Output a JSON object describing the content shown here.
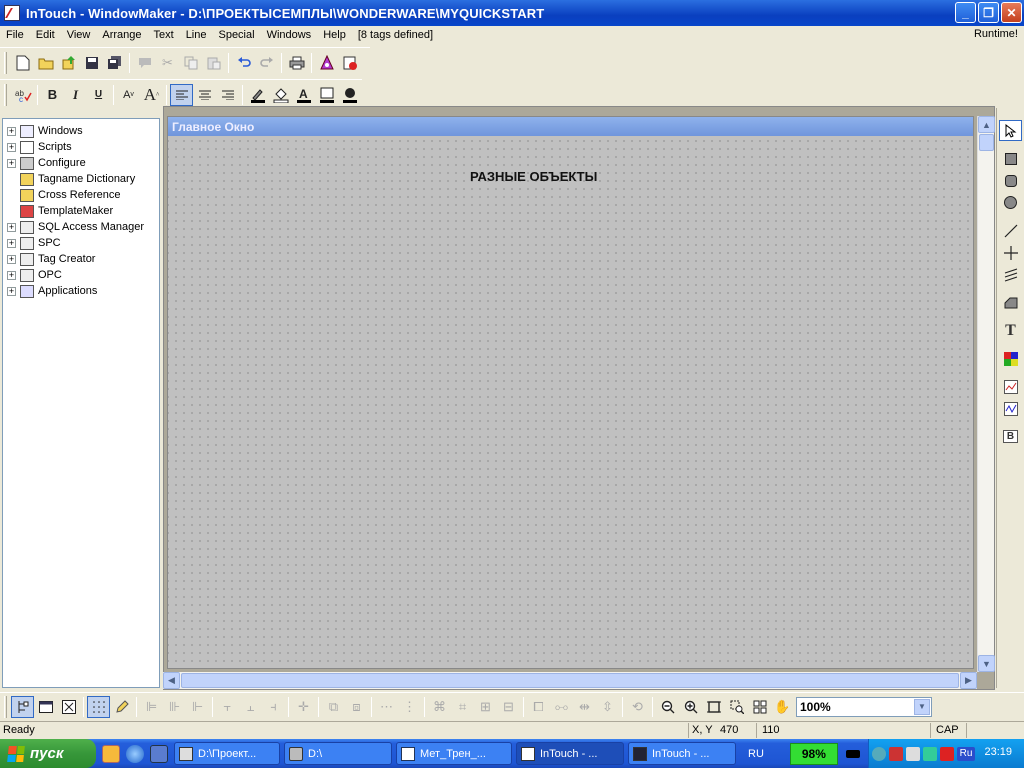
{
  "window": {
    "title": "InTouch - WindowMaker - D:\\ПРОЕКТЫСЕМПЛЫ\\WONDERWARE\\MYQUICKSTART",
    "minimize_label": "_",
    "maximize_label": "❐",
    "close_label": "✕"
  },
  "menu": {
    "items": [
      "File",
      "Edit",
      "View",
      "Arrange",
      "Text",
      "Line",
      "Special",
      "Windows",
      "Help",
      "[8 tags defined]"
    ],
    "runtime_label": "Runtime!"
  },
  "toolbar_text": {
    "bold": "B",
    "italic": "I",
    "underline": "U",
    "font_smaller": "A",
    "font_larger": "A"
  },
  "tree": {
    "items": [
      {
        "label": "Windows",
        "expandable": true
      },
      {
        "label": "Scripts",
        "expandable": true
      },
      {
        "label": "Configure",
        "expandable": true
      },
      {
        "label": "Tagname Dictionary",
        "expandable": false
      },
      {
        "label": "Cross Reference",
        "expandable": false
      },
      {
        "label": "TemplateMaker",
        "expandable": false
      },
      {
        "label": "SQL Access Manager",
        "expandable": true
      },
      {
        "label": "SPC",
        "expandable": true
      },
      {
        "label": "Tag Creator",
        "expandable": true
      },
      {
        "label": "OPC",
        "expandable": true
      },
      {
        "label": "Applications",
        "expandable": true
      }
    ]
  },
  "canvas": {
    "window_title": "Главное Окно",
    "text_object": "РАЗНЫЕ ОБЪЕКТЫ"
  },
  "palette": {
    "text_tool": "T",
    "button_tool": "B"
  },
  "zoom": {
    "value": "100%"
  },
  "status": {
    "state": "Ready",
    "xy_label": "X, Y",
    "x": "470",
    "y": "110",
    "caps": "CAP"
  },
  "taskbar": {
    "start_label": "пуск",
    "tasks": [
      "D:\\Проект...",
      "D:\\",
      "Мет_Трен_...",
      "InTouch - ...",
      "InTouch - ..."
    ],
    "language": "RU",
    "battery": "98%",
    "tray_language": "Ru",
    "clock": "23:19"
  },
  "colors": {
    "titlebar": "#0a3fbf",
    "canvas_bg": "#c0c0c0",
    "canvas_title": "#7fa4e4",
    "taskbar": "#245edb",
    "start": "#37973a"
  }
}
